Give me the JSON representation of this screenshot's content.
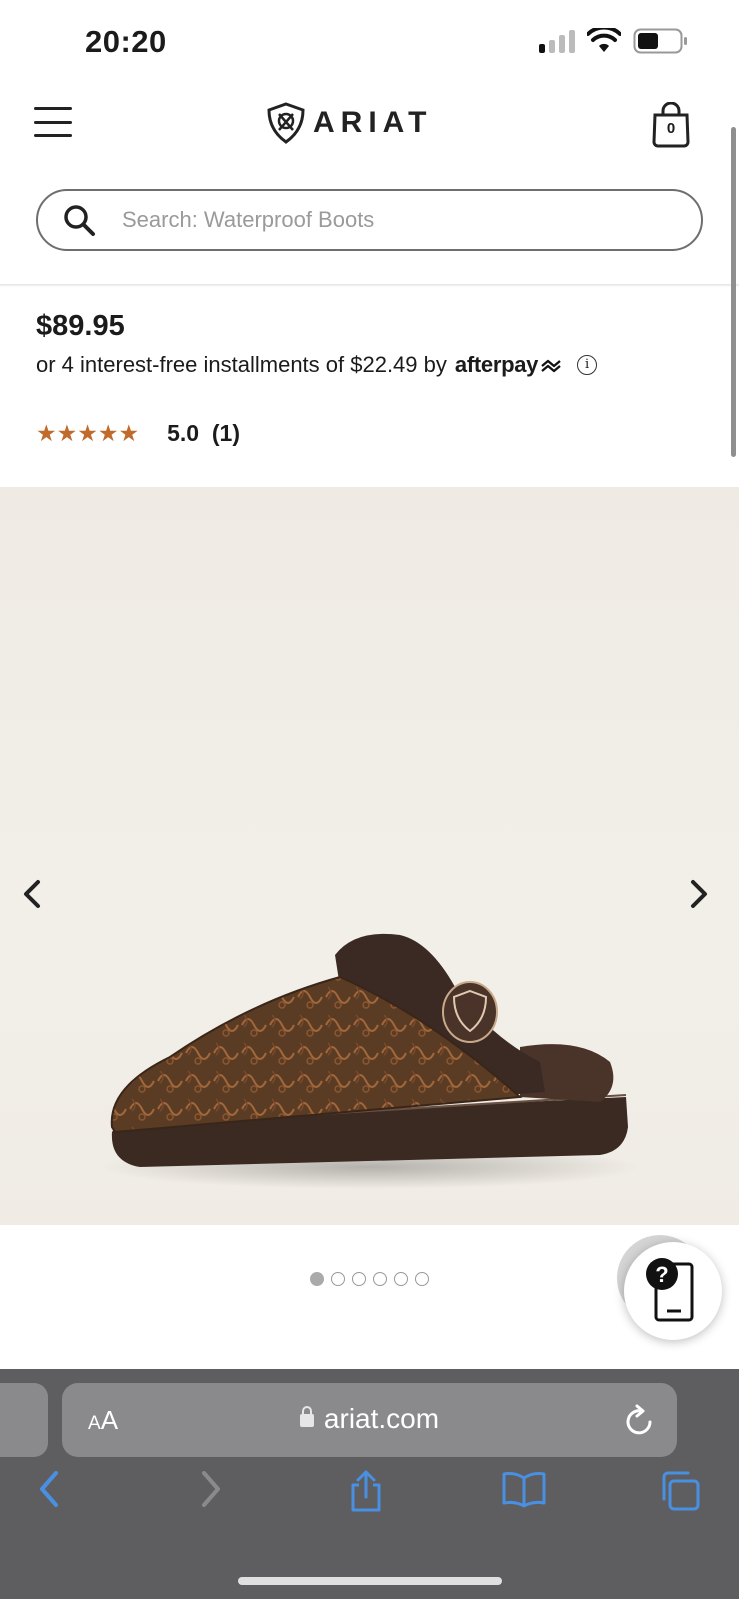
{
  "status_bar": {
    "time": "20:20"
  },
  "header": {
    "brand": "ARIAT",
    "cart_count": "0"
  },
  "search": {
    "placeholder": "Search: Waterproof Boots"
  },
  "product": {
    "price": "$89.95",
    "installment_text": "or 4 interest-free installments of $22.49 by",
    "afterpay_label": "afterpay",
    "info_glyph": "i",
    "rating_stars": "★★★★★",
    "rating_value": "5.0",
    "review_count": "(1)",
    "image_index": 1,
    "image_count": 6
  },
  "help": {
    "glyph": "?"
  },
  "browser": {
    "aa_small": "A",
    "aa_large": "A",
    "url": "ariat.com"
  },
  "icons": {
    "menu": "hamburger-icon",
    "bag": "shopping-bag-icon",
    "search": "search-icon",
    "prev": "chevron-left-icon",
    "next": "chevron-right-icon",
    "help": "help-phone-icon",
    "back": "back-arrow-icon",
    "forward": "forward-arrow-icon",
    "share": "share-icon",
    "bookmarks": "book-icon",
    "tabs": "tabs-icon"
  },
  "colors": {
    "star": "#c06a2b",
    "browser_accent": "#4a90e2"
  }
}
